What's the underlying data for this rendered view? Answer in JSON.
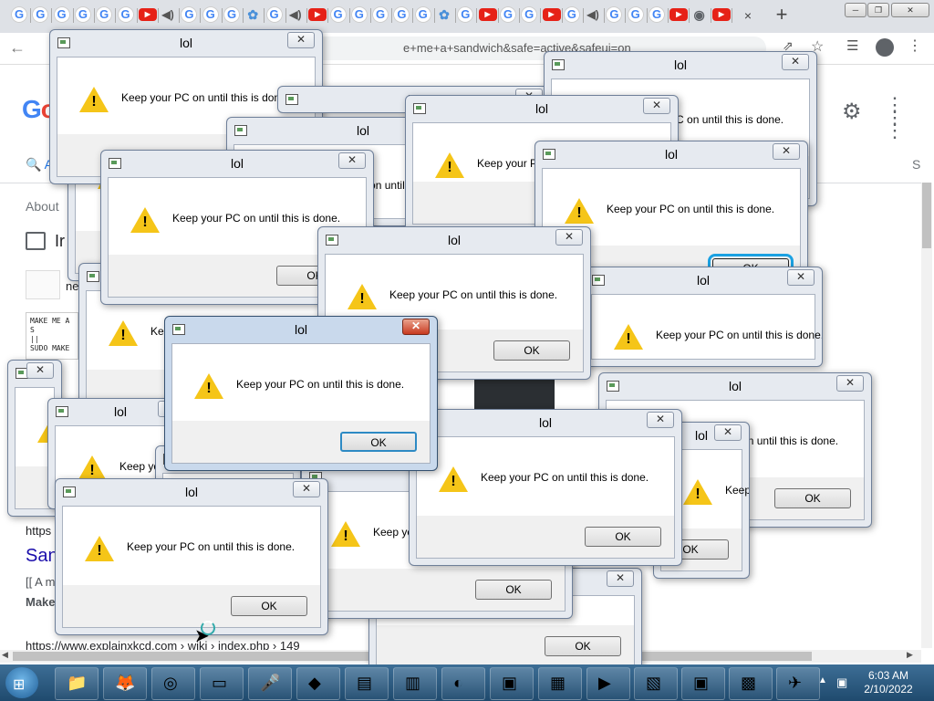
{
  "browser": {
    "tab_favicons": [
      "G",
      "G",
      "G",
      "G",
      "G",
      "G",
      "yt",
      "spk",
      "G",
      "G",
      "G",
      "blue",
      "G",
      "spk",
      "yt",
      "G",
      "G",
      "G",
      "G",
      "G",
      "blue",
      "G",
      "yt",
      "G",
      "G",
      "yt",
      "G",
      "spk",
      "G",
      "G",
      "G",
      "yt",
      "glb",
      "yt"
    ],
    "tab_close": "×",
    "new_tab": "+",
    "url_visible": "e+me+a+sandwich&safe=active&safeui=on",
    "window_buttons": [
      "─",
      "❐",
      "✕"
    ]
  },
  "google": {
    "logo_visible": [
      "G",
      "o"
    ],
    "search_tab_label": "A",
    "search_tab_right": "S",
    "about_text": "About",
    "image_row_text": "Ir",
    "thumb1_text": "ne",
    "thumb2_lines": [
      "MAKE ME A S",
      "||",
      "SUDO MAKE"
    ],
    "result_url": "https",
    "result_title": "San",
    "snippet1": "[[ A m",
    "snippet2": "Make",
    "explain_url": "https://www.explainxkcd.com › wiki › index.php › 149"
  },
  "dialog": {
    "title": "lol",
    "message": "Keep your PC on until this is done.",
    "ok": "OK",
    "close": "✕",
    "close_glyph_active": "✕"
  },
  "partial_texts": {
    "til_th": "until th",
    "til_this": "until this is done.",
    "this_done_ital": "this is done.",
    "keep_trunc": "Keep you",
    "keep_yo": "Keep yo",
    "keep_your_pc": "Keep your PC",
    "done": "done.",
    "ok_trunc": "O",
    "kee": "Kee",
    "lol_partial": "lo"
  },
  "taskbar": {
    "time": "6:03 AM",
    "date": "2/10/2022",
    "icons": [
      "folder-icon",
      "firefox-icon",
      "chrome-icon",
      "window-icon",
      "microphone-icon",
      "cube-icon",
      "book-icon",
      "printer-icon",
      "disc-icon",
      "toolbox-icon",
      "monitor-icon",
      "media-icon",
      "network-icon",
      "toolbox-red-icon",
      "package-icon",
      "satellite-icon"
    ]
  }
}
